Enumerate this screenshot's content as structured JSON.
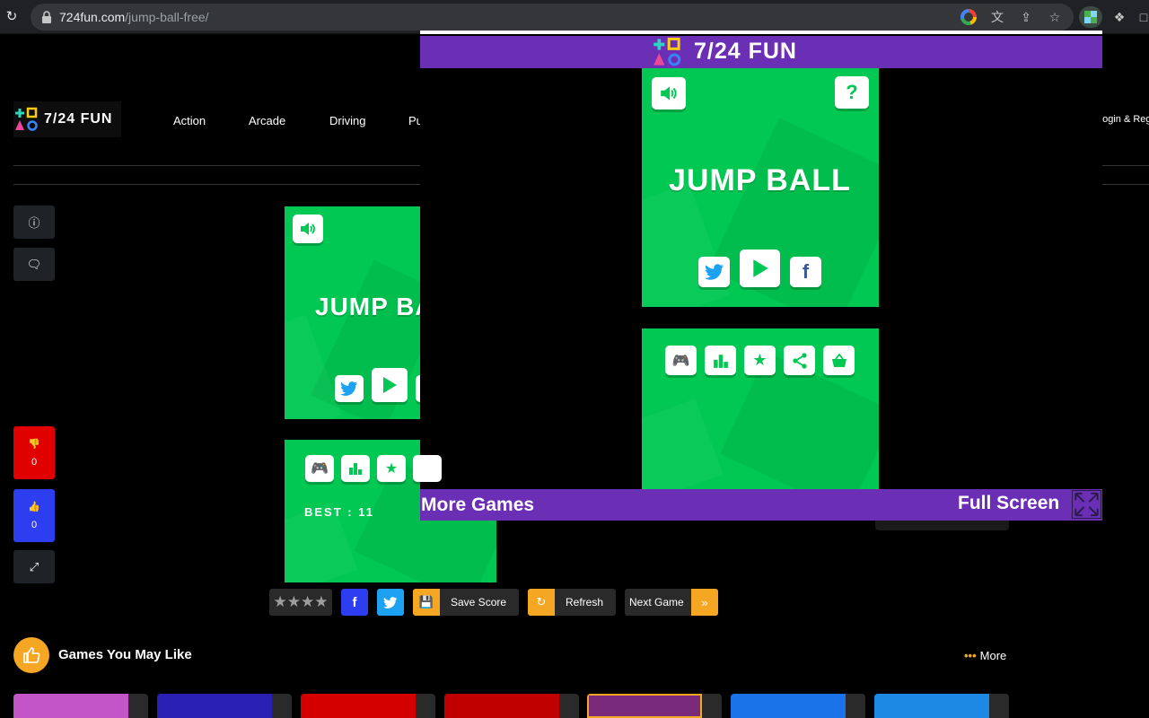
{
  "browser": {
    "url_domain": "724fun.com",
    "url_path": "/jump-ball-free/"
  },
  "site": {
    "logo_text": "7/24 FUN",
    "nav": [
      "Action",
      "Arcade",
      "Driving",
      "Pu"
    ],
    "login": "Login & Reg"
  },
  "side": {
    "dislike_count": "0",
    "like_count": "0"
  },
  "game": {
    "title": "JUMP BALL",
    "title_clipped": "JUMP BA",
    "best_label": "BEST : 11"
  },
  "actions": {
    "save_score": "Save Score",
    "refresh": "Refresh",
    "next_game": "Next Game",
    "rating_stars": 4
  },
  "related": {
    "title": "Games You May Like",
    "more": "More",
    "thumb_colors": [
      "#c355c9",
      "#2a1fb3",
      "#d40000",
      "#c00000",
      "#7a2a7a",
      "#1a73e8",
      "#1e88e5"
    ]
  },
  "overlay": {
    "logo_text": "7/24 FUN",
    "more_games": "More Games",
    "full_screen": "Full Screen"
  },
  "colors": {
    "game_green": "#00c853",
    "overlay_purple": "#6a2fb5",
    "accent_orange": "#f5a623",
    "dislike_red": "#e00000",
    "like_blue": "#2d3df0"
  }
}
